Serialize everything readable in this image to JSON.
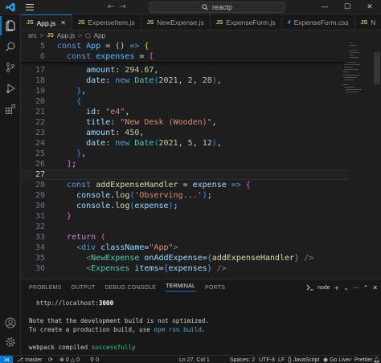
{
  "titlebar": {
    "search_text": "reactp",
    "nav_back": "←",
    "nav_forward": "→",
    "minimize": "—",
    "maximize": "☐",
    "close": "✕"
  },
  "tabs": [
    {
      "badge": "JS",
      "label": "App.js",
      "active": true
    },
    {
      "badge": "JS",
      "label": "ExpenseItem.js"
    },
    {
      "badge": "JS",
      "label": "NewExpense.js"
    },
    {
      "badge": "JS",
      "label": "ExpenseForm.js"
    },
    {
      "badge": "#",
      "label": "ExpenseForm.css"
    },
    {
      "badge": "JS",
      "label": "N"
    }
  ],
  "breadcrumb": {
    "folder": "src",
    "sep": ">",
    "file_badge": "JS",
    "file": "App.js",
    "symbol": "App"
  },
  "editor": {
    "sticky": [
      {
        "n": "5",
        "text": "const App = () => {"
      },
      {
        "n": "6",
        "text": "  const expenses = ["
      }
    ],
    "lines": [
      {
        "n": "17",
        "text": "      amount: 294.67,"
      },
      {
        "n": "18",
        "text": "      date: new Date(2021, 2, 28),"
      },
      {
        "n": "19",
        "text": "    },"
      },
      {
        "n": "20",
        "text": "    {"
      },
      {
        "n": "21",
        "text": "      id: \"e4\","
      },
      {
        "n": "22",
        "text": "      title: \"New Desk (Wooden)\","
      },
      {
        "n": "23",
        "text": "      amount: 450,"
      },
      {
        "n": "24",
        "text": "      date: new Date(2021, 5, 12),"
      },
      {
        "n": "25",
        "text": "    },"
      },
      {
        "n": "26",
        "text": "  ];"
      },
      {
        "n": "27",
        "text": ""
      },
      {
        "n": "28",
        "text": "  const addExpenseHandler = expense => {"
      },
      {
        "n": "29",
        "text": "    console.log('Observing...');"
      },
      {
        "n": "30",
        "text": "    console.log(expense);"
      },
      {
        "n": "31",
        "text": "  }"
      },
      {
        "n": "32",
        "text": ""
      },
      {
        "n": "33",
        "text": "  return ("
      },
      {
        "n": "34",
        "text": "    <div className=\"App\">"
      },
      {
        "n": "35",
        "text": "      <NewExpense onAddExpense={addExpenseHandler} />"
      },
      {
        "n": "36",
        "text": "      <Expenses items={expenses} />"
      }
    ],
    "current_line": "27"
  },
  "panel": {
    "tabs": [
      "PROBLEMS",
      "OUTPUT",
      "DEBUG CONSOLE",
      "TERMINAL",
      "PORTS"
    ],
    "active_tab": "TERMINAL",
    "terminal_name": "node",
    "plus": "+",
    "more": "···",
    "close": "✕",
    "terminal_lines": [
      {
        "segments": [
          {
            "t": "  http://localhost:",
            "c": ""
          },
          {
            "t": "3000",
            "c": "bold"
          }
        ]
      },
      {
        "segments": [
          {
            "t": "",
            "c": ""
          }
        ]
      },
      {
        "segments": [
          {
            "t": "Note that the development build is not optimized.",
            "c": ""
          }
        ]
      },
      {
        "segments": [
          {
            "t": "To create a production build, use ",
            "c": ""
          },
          {
            "t": "npm run build",
            "c": "cyan"
          },
          {
            "t": ".",
            "c": ""
          }
        ]
      },
      {
        "segments": [
          {
            "t": "",
            "c": ""
          }
        ]
      },
      {
        "segments": [
          {
            "t": "webpack compiled ",
            "c": ""
          },
          {
            "t": "successfully",
            "c": "green"
          }
        ]
      }
    ]
  },
  "statusbar": {
    "remote": "⋊",
    "branch": "master",
    "errors": "0",
    "warnings": "0",
    "ports": "0",
    "position": "Ln 27, Col 1",
    "spaces": "Spaces: 2",
    "encoding": "UTF-8",
    "eol": "LF",
    "language": "JavaScript",
    "golive": "Go Live",
    "prettier": "Prettier"
  },
  "colors": {
    "accent": "#0078d4",
    "js_badge": "#cbcb41",
    "css_badge": "#42a5f5",
    "success": "#23d18b"
  }
}
